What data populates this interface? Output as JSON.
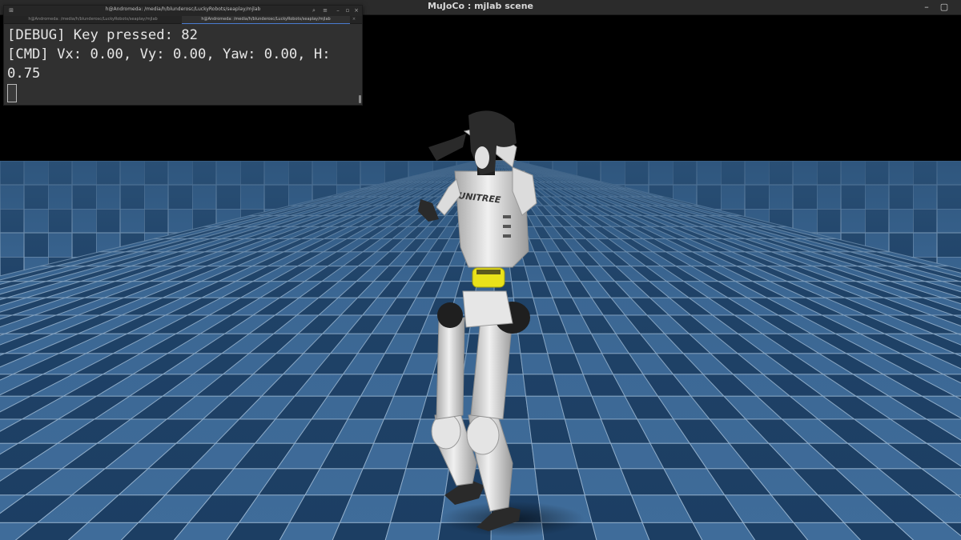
{
  "window": {
    "title": "MuJoCo : mjlab scene",
    "minimize_glyph": "–",
    "maximize_glyph": "▢"
  },
  "terminal": {
    "title": "h@Andromeda: /media/h/blunderosc/LuckyRobots/seaplay/mjlab",
    "tabs": [
      {
        "label": "h@Andromeda: /media/h/blunderosc/LuckyRobots/seaplay/mjlab",
        "active": false
      },
      {
        "label": "h@Andromeda: /media/h/blunderosc/LuckyRobots/seaplay/mjlab",
        "active": true
      }
    ],
    "lines": [
      "[DEBUG] Key pressed: 82",
      "[CMD] Vx: 0.00, Vy: 0.00, Yaw: 0.00, H:",
      "0.75"
    ],
    "search_icon": "search-icon",
    "menu_icon": "menu-icon"
  },
  "robot": {
    "brand_text": "UNITREE"
  },
  "colors": {
    "sky": "#000000",
    "floor_light": "#3f6c9a",
    "floor_dark": "#1c3e63",
    "grid_line": "#a7c1db",
    "body": "#d9d9d9",
    "joint_dark": "#222222",
    "waist_yellow": "#e9e21a"
  }
}
